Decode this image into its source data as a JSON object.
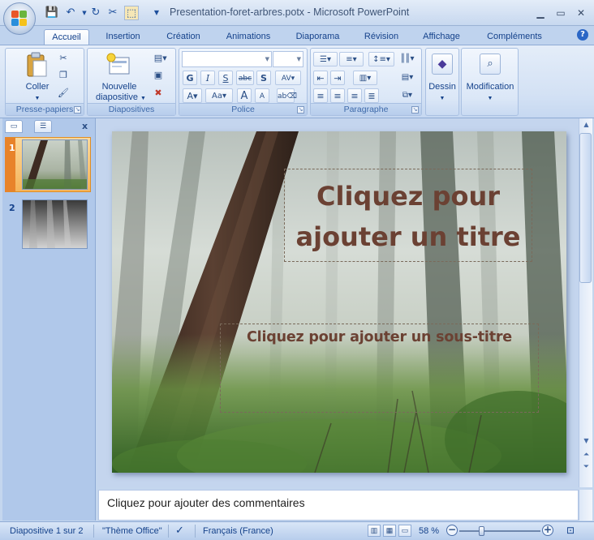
{
  "window": {
    "title": "Presentation-foret-arbres.potx - Microsoft PowerPoint",
    "minimize_icon": "minimize-icon",
    "restore_icon": "restore-icon",
    "close_icon": "close-icon"
  },
  "tabs": [
    {
      "label": "Accueil",
      "active": true
    },
    {
      "label": "Insertion"
    },
    {
      "label": "Création"
    },
    {
      "label": "Animations"
    },
    {
      "label": "Diaporama"
    },
    {
      "label": "Révision"
    },
    {
      "label": "Affichage"
    },
    {
      "label": "Compléments"
    }
  ],
  "ribbon": {
    "clipboard": {
      "label": "Presse-papiers",
      "paste_label": "Coller"
    },
    "slides": {
      "label": "Diapositives",
      "new_slide_label_1": "Nouvelle",
      "new_slide_label_2": "diapositive"
    },
    "font": {
      "label": "Police",
      "font_name": "",
      "font_size": ""
    },
    "paragraph": {
      "label": "Paragraphe"
    },
    "drawing": {
      "label": "Dessin"
    },
    "editing": {
      "label": "Modification"
    }
  },
  "slides_panel": {
    "thumbnails": [
      {
        "number": "1",
        "selected": true
      },
      {
        "number": "2",
        "selected": false
      }
    ]
  },
  "slide": {
    "title_placeholder_1": "Cliquez pour",
    "title_placeholder_2": "ajouter un titre",
    "subtitle_placeholder": "Cliquez pour ajouter un sous-titre"
  },
  "notes": {
    "placeholder": "Cliquez pour ajouter des commentaires"
  },
  "status": {
    "slide_position": "Diapositive 1 sur 2",
    "theme": "\"Thème Office\"",
    "language": "Français (France)",
    "zoom": "58 %",
    "zoom_fraction": 0.58
  },
  "colors": {
    "ribbon_text": "#15428b",
    "title_text": "#6b4133",
    "selected_thumb": "#f5b45a"
  }
}
